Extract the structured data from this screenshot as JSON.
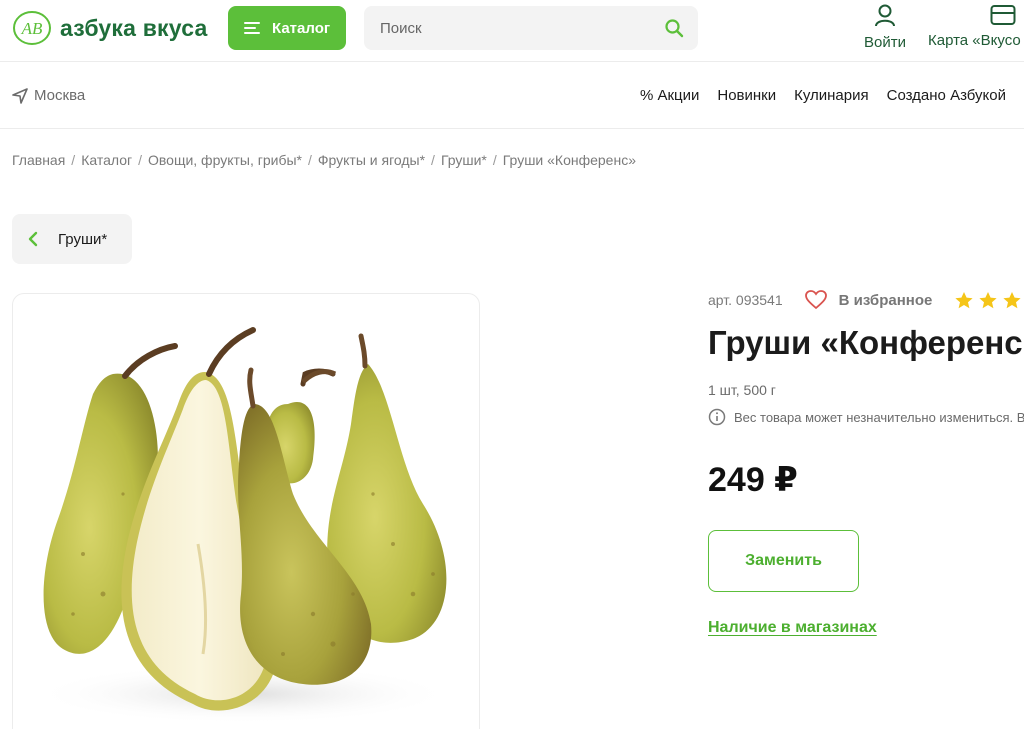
{
  "brand": {
    "name": "азбука вкуса",
    "logo_text": "АВ",
    "accent": "#5cbf3a",
    "brand_green": "#1f6e3a"
  },
  "header": {
    "catalog_label": "Каталог",
    "search_placeholder": "Поиск",
    "login_label": "Войти",
    "card_label": "Карта «Вкусо"
  },
  "subheader": {
    "city": "Москва",
    "nav": [
      "% Акции",
      "Новинки",
      "Кулинария",
      "Создано Азбукой"
    ]
  },
  "breadcrumb": [
    "Главная",
    "Каталог",
    "Овощи, фрукты, грибы*",
    "Фрукты и ягоды*",
    "Груши*",
    "Груши «Конференс»"
  ],
  "back": {
    "label": "Груши*"
  },
  "product": {
    "article": "арт. 093541",
    "favorite_label": "В избранное",
    "title": "Груши «Конференс»",
    "weight": "1 шт, 500 г",
    "note": "Вес товара может незначительно измениться. В",
    "price": "249 ₽",
    "replace_label": "Заменить",
    "availability_label": "Наличие в магазинах",
    "star_color": "#f5c518"
  },
  "icons": [
    "logo-icon",
    "menu-icon",
    "search-icon",
    "user-icon",
    "card-icon",
    "location-icon",
    "chevron-left-icon",
    "heart-icon",
    "star-icon",
    "info-icon"
  ]
}
